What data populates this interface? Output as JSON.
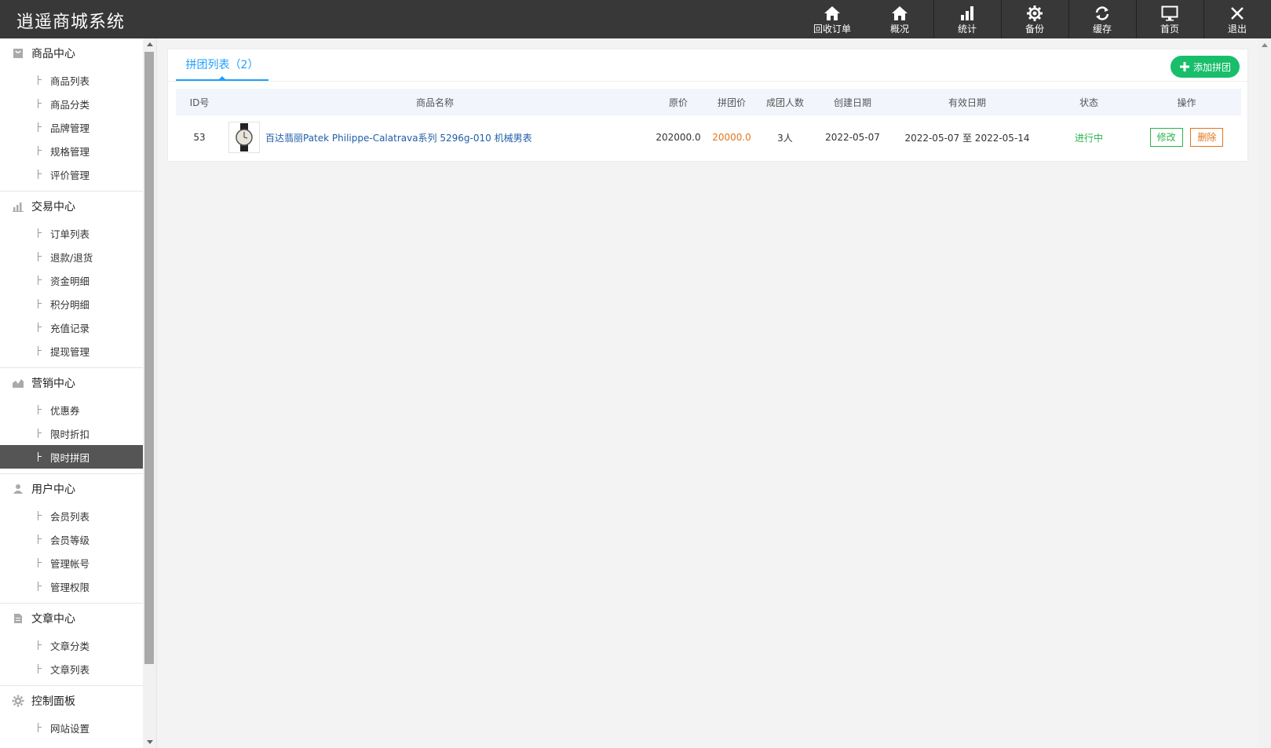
{
  "app": {
    "title": "逍遥商城系统"
  },
  "topnav": [
    {
      "label": "回收订单",
      "icon": "home-icon"
    },
    {
      "label": "概况",
      "icon": "home-icon"
    },
    {
      "label": "统计",
      "icon": "bar-chart-icon"
    },
    {
      "label": "备份",
      "icon": "gear-icon"
    },
    {
      "label": "缓存",
      "icon": "refresh-icon"
    },
    {
      "label": "首页",
      "icon": "monitor-icon"
    },
    {
      "label": "退出",
      "icon": "close-icon"
    }
  ],
  "sidebar": {
    "groups": [
      {
        "title": "商品中心",
        "icon": "bag-icon",
        "items": [
          "商品列表",
          "商品分类",
          "品牌管理",
          "规格管理",
          "评价管理"
        ]
      },
      {
        "title": "交易中心",
        "icon": "bar-chart-icon",
        "items": [
          "订单列表",
          "退款/退货",
          "资金明细",
          "积分明细",
          "充值记录",
          "提现管理"
        ]
      },
      {
        "title": "营销中心",
        "icon": "area-chart-icon",
        "items": [
          "优惠券",
          "限时折扣",
          "限时拼团"
        ]
      },
      {
        "title": "用户中心",
        "icon": "user-icon",
        "items": [
          "会员列表",
          "会员等级",
          "管理帐号",
          "管理权限"
        ]
      },
      {
        "title": "文章中心",
        "icon": "document-icon",
        "items": [
          "文章分类",
          "文章列表"
        ]
      },
      {
        "title": "控制面板",
        "icon": "gear-icon",
        "items": [
          "网站设置"
        ]
      }
    ],
    "active_item": "限时拼团"
  },
  "main": {
    "tab_label": "拼团列表（2）",
    "add_button": "添加拼团",
    "columns": [
      "ID号",
      "商品名称",
      "原价",
      "拼团价",
      "成团人数",
      "创建日期",
      "有效日期",
      "状态",
      "操作"
    ],
    "rows": [
      {
        "id": "53",
        "name": "百达翡丽Patek Philippe-Calatrava系列 5296g-010 机械男表",
        "original_price": "202000.0",
        "group_price": "20000.0",
        "group_size": "3人",
        "created": "2022-05-07",
        "valid": "2022-05-07 至 2022-05-14",
        "status": "进行中",
        "edit_label": "修改",
        "delete_label": "删除"
      }
    ]
  },
  "colors": {
    "header_bg": "#383838",
    "accent": "#1e9fff",
    "add_green": "#19be6b",
    "status_green": "#2bb34a",
    "price_orange": "#e4751a",
    "link_blue": "#1f5ea8"
  }
}
